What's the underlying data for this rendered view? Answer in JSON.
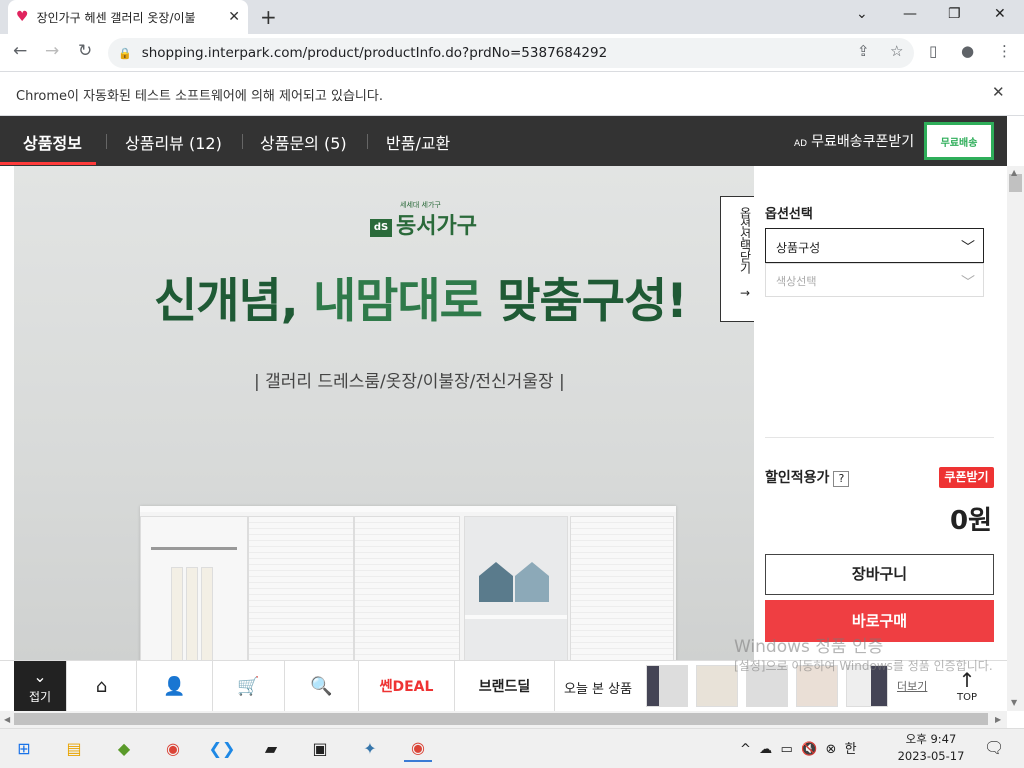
{
  "browser": {
    "tab_title": "장인가구 헤센 갤러리 옷장/이불",
    "new_tab": "+",
    "url": "shopping.interpark.com/product/productInfo.do?prdNo=5387684292",
    "infobar_message": "Chrome이 자동화된 테스트 소프트웨어에 의해 제어되고 있습니다."
  },
  "page_tabs": [
    {
      "label": "상품정보"
    },
    {
      "label": "상품리뷰 (12)"
    },
    {
      "label": "상품문의 (5)"
    },
    {
      "label": "반품/교환"
    }
  ],
  "ad": {
    "tag": "AD",
    "label": "무료배송쿠폰받기",
    "badge": "무료배송"
  },
  "hero": {
    "brand_small": "세세대 세가구",
    "brand": "동서가구",
    "headline_a": "신개념, ",
    "headline_b": "내맘대로",
    "headline_c": " 맞춤구성!",
    "subline": "| 갤러리 드레스룸/옷장/이불장/전신거울장 |"
  },
  "options": {
    "toggle_label": "옵션선택닫기 →",
    "title": "옵션선택",
    "select1": "상품구성",
    "select2": "색상선택"
  },
  "pricing": {
    "discount_label": "할인적용가",
    "help": "?",
    "coupon_button": "쿠폰받기",
    "price": "0원",
    "cart_button": "장바구니",
    "buy_button": "바로구매"
  },
  "quickbar": {
    "fold_label": "접기",
    "deal1": "쎈DEAL",
    "deal2": "브랜드딜",
    "recent_label": "오늘 본 상품",
    "more": "더보기",
    "top": "TOP"
  },
  "watermark": {
    "line1": "Windows 정품 인증",
    "line2": "[설정]으로 이동하여 Windows를 정품 인증합니다."
  },
  "taskbar": {
    "time": "오후 9:47",
    "date": "2023-05-17",
    "ime": "한"
  }
}
